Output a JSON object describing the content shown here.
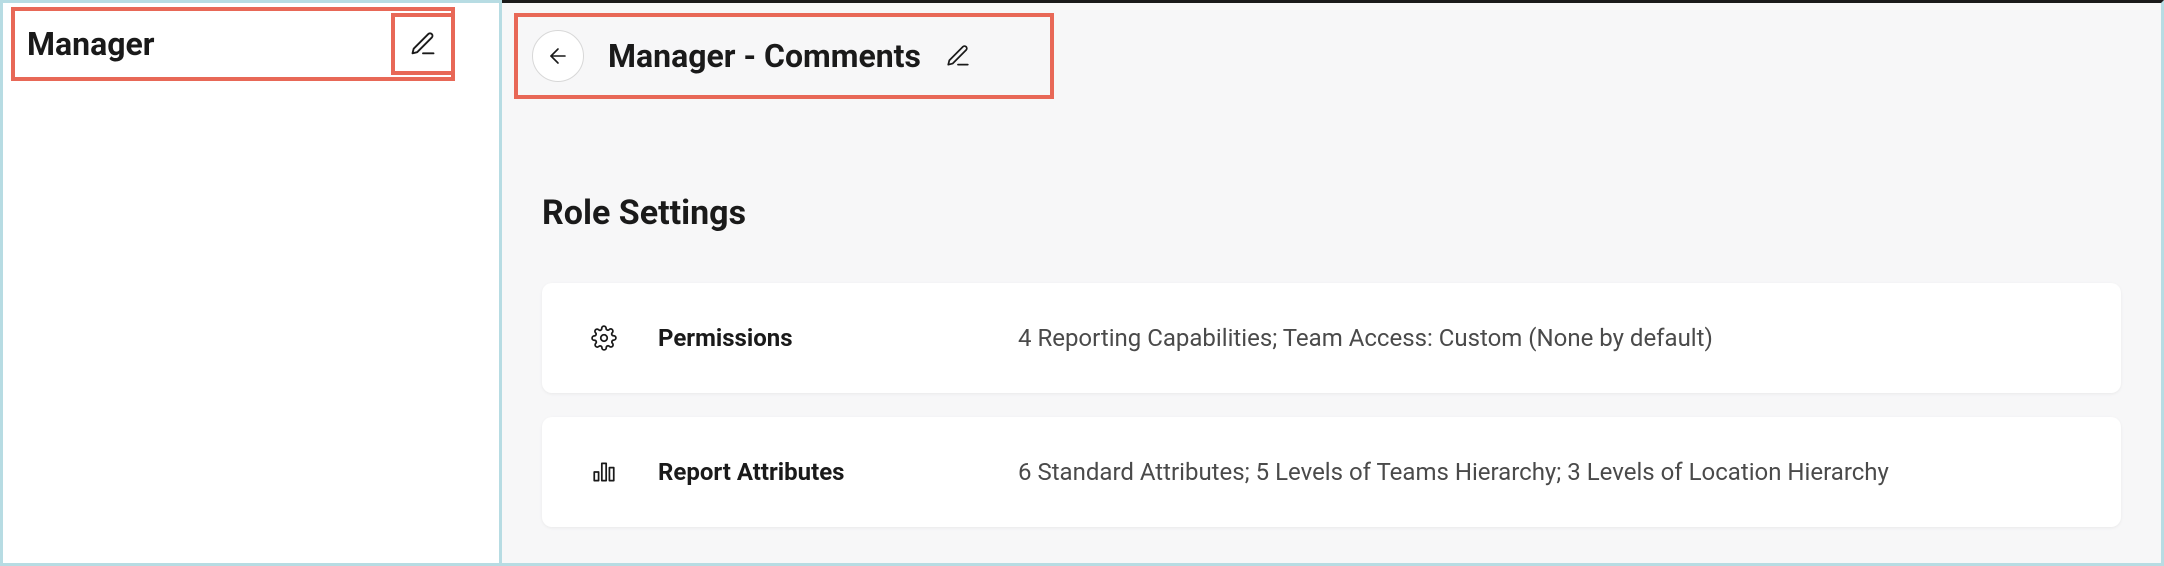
{
  "sidebar": {
    "title": "Manager"
  },
  "header": {
    "title": "Manager - Comments"
  },
  "section": {
    "title": "Role Settings"
  },
  "cards": [
    {
      "label": "Permissions",
      "description": "4 Reporting Capabilities; Team Access: Custom (None by default)"
    },
    {
      "label": "Report Attributes",
      "description": "6 Standard Attributes; 5 Levels of Teams Hierarchy; 3 Levels of Location Hierarchy"
    }
  ]
}
